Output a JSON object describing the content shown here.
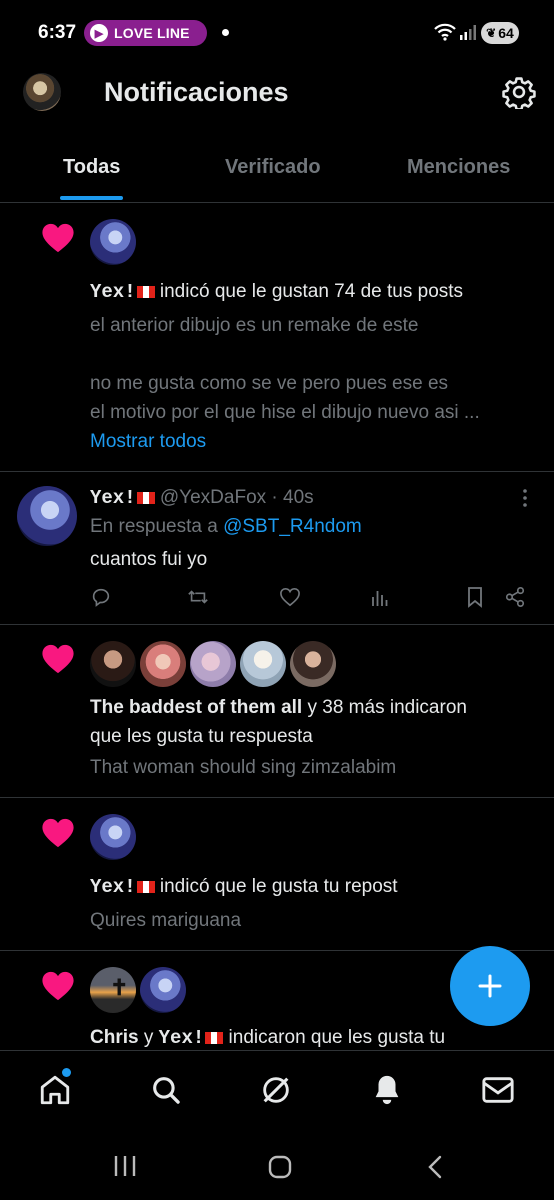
{
  "status_bar": {
    "time": "6:37",
    "pill_label": "LOVE LINE",
    "battery": "64"
  },
  "header": {
    "title": "Notificaciones"
  },
  "tabs": [
    {
      "label": "Todas"
    },
    {
      "label": "Verificado"
    },
    {
      "label": "Menciones"
    }
  ],
  "notifications": {
    "n1": {
      "user": "Yex!",
      "action": "indicó que le gustan 74 de tus posts",
      "line1": "el anterior dibujo es un remake de este",
      "line2": "no me gusta como se ve pero pues ese es",
      "line3": "el motivo por el que hise el dibujo nuevo asi ...",
      "show_all": "Mostrar todos"
    },
    "reply": {
      "name": "Yex!",
      "handle": "@YexDaFox",
      "time": "· 40s",
      "reply_prefix": "En respuesta a",
      "reply_to": "@SBT_R4ndom",
      "text": "cuantos fui yo"
    },
    "n3": {
      "user": "The baddest of them all",
      "action_a": "y 38 más indicaron",
      "action_b": "que les gusta tu respuesta",
      "quote": "That woman should sing zimzalabim"
    },
    "n4": {
      "user": "Yex!",
      "action": "indicó que le gusta tu repost",
      "quote": "Quires mariguana"
    },
    "n5": {
      "user_a": "Chris",
      "joiner": "y",
      "user_b": "Yex!",
      "action": "indicaron que les gusta tu"
    }
  },
  "colors": {
    "accent": "#1d9bf0",
    "heart": "#f91880",
    "background": "#000000",
    "pill": "#8a1f8f"
  }
}
